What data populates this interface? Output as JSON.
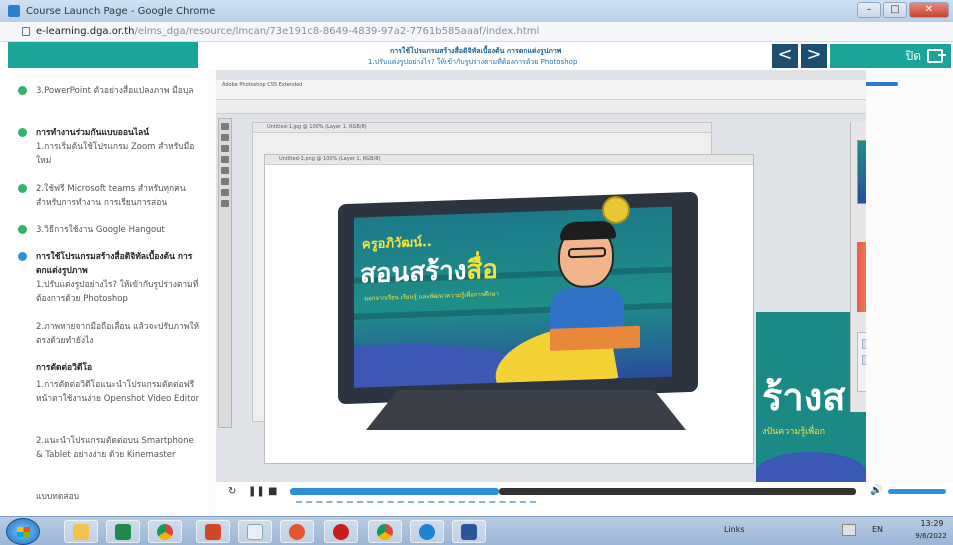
{
  "window": {
    "title": "Course Launch Page - Google Chrome"
  },
  "address": {
    "host": "e-learning.dga.or.th",
    "path": "/elms_dga/resource/lmcan/73e191c8-8649-4839-97a2-7761b585aaaf/index.html"
  },
  "header": {
    "lesson_title": "การใช้โปรแกรมสร้างสื่อดิจิทัลเบื้องต้น การตกแต่งรูปภาพ",
    "lesson_subtitle": "1.ปรับแต่งรูปอย่างไร? ให้เข้ากับรูปร่างตามที่ต้องการด้วย Photoshop",
    "prev_label": "<",
    "next_label": ">",
    "exit_label": "ปิด"
  },
  "sidebar": {
    "items": [
      {
        "text": "3.PowerPoint ตัวอย่างสื่อแปลงภาพ มือบุล",
        "bold": false,
        "dot": true,
        "active": false
      },
      {
        "text": "การทำงานร่วมกันแบบออนไลน์",
        "bold": true,
        "dot": true,
        "active": false
      },
      {
        "text": "1.การเริ่มต้นใช้โปรแกรม Zoom สำหรับมือใหม่",
        "bold": false,
        "dot": false,
        "active": false
      },
      {
        "text": "2.ใช้ฟรี Microsoft teams สำหรับทุกคน สำหรับการทำงาน การเรียนการสอน",
        "bold": false,
        "dot": true,
        "active": false
      },
      {
        "text": "3.วิธีการใช้งาน Google Hangout",
        "bold": false,
        "dot": true,
        "active": false
      },
      {
        "text": "การใช้โปรแกรมสร้างสื่อดิจิทัลเบื้องต้น การตกแต่งรูปภาพ",
        "bold": true,
        "dot": true,
        "active": true
      },
      {
        "text": "1.ปรับแต่งรูปอย่างไร? ให้เข้ากับรูปร่างตามที่ต้องการด้วย Photoshop",
        "bold": false,
        "dot": false,
        "active": true
      },
      {
        "text": "2.ภาพหายจากมือถือเลื่อน แล้วจะปรับภาพให้ตรงด้วยทำยังไง",
        "bold": false,
        "dot": false,
        "active": false
      },
      {
        "text": "การตัดต่อวิดีโอ",
        "bold": true,
        "dot": false,
        "active": false
      },
      {
        "text": "1.การตัดต่อวิดีโอแนะนำโปรแกรมตัดต่อฟรี หน้าตาใช้งานง่าย Openshot Video Editor",
        "bold": false,
        "dot": false,
        "active": false
      },
      {
        "text": "2.แนะนำโปรแกรมตัดต่อบน Smartphone & Tablet อย่างง่าย ด้วย Kinemaster",
        "bold": false,
        "dot": false,
        "active": false
      },
      {
        "text": "แบบทดสอบ",
        "bold": false,
        "dot": false,
        "active": false
      }
    ]
  },
  "video": {
    "app_title": "Adobe Photoshop CS5 Extended",
    "doc_back_title": "Untitled-1.jpg @ 100% (Layer 1, RGB/8)",
    "doc_title": "Untitled-1.png @ 100% (Layer 1, RGB/8)",
    "art_name": "ครูอภิวัฒน์..",
    "art_main": "สอนสร้าง",
    "art_main_highlight": "สื่อ",
    "art_tagline": "นอกจากเรียน เรียนรู้ และพัฒนาความรู้เพื่อการศึกษา",
    "bg_art_text": "ร้างส",
    "bg_art_sub": "งปันความรู้เพื่อก"
  },
  "player": {
    "replay_icon": "replay-icon",
    "pause_icon": "pause-icon",
    "stop_icon": "stop-icon",
    "volume_icon": "volume-icon",
    "progress": 0.37
  },
  "taskbar": {
    "links_label": "Links",
    "lang": "EN",
    "time": "13:29",
    "date": "9/6/2022"
  }
}
